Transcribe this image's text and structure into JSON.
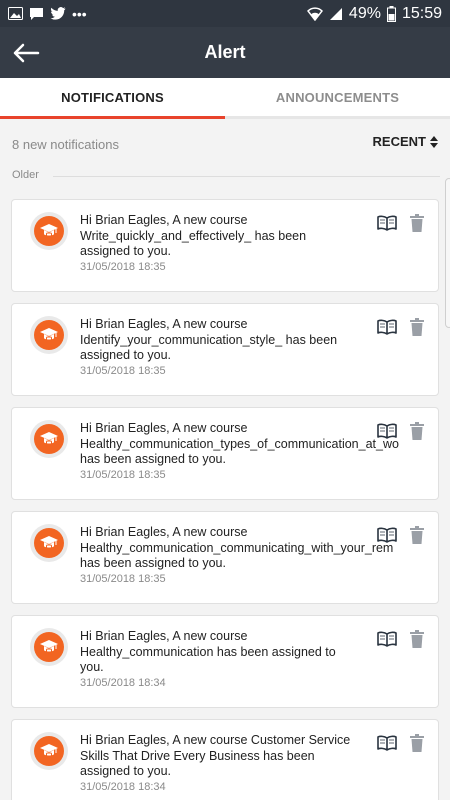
{
  "status_bar": {
    "battery": "49%",
    "time": "15:59"
  },
  "header": {
    "title": "Alert"
  },
  "tabs": [
    {
      "label": "NOTIFICATIONS",
      "active": true
    },
    {
      "label": "ANNOUNCEMENTS",
      "active": false
    }
  ],
  "summary": "8 new notifications",
  "sort_label": "RECENT",
  "section_label": "Older",
  "notifications": [
    {
      "lines": [
        "Hi Brian Eagles, A new course",
        "Write_quickly_and_effectively_ has been",
        "assigned to you."
      ],
      "timestamp": "31/05/2018 18:35"
    },
    {
      "lines": [
        "Hi Brian Eagles, A new course",
        "Identify_your_communication_style_ has been",
        "assigned to you."
      ],
      "timestamp": "31/05/2018 18:35"
    },
    {
      "lines": [
        "Hi Brian Eagles, A new course",
        "Healthy_communication_types_of_communication_at_wo",
        "has been assigned to you."
      ],
      "timestamp": "31/05/2018 18:35"
    },
    {
      "lines": [
        "Hi Brian Eagles, A new course",
        "Healthy_communication_communicating_with_your_rem",
        "has been assigned to you."
      ],
      "timestamp": "31/05/2018 18:35"
    },
    {
      "lines": [
        "Hi Brian Eagles, A new course",
        "Healthy_communication has been assigned to",
        "you."
      ],
      "timestamp": "31/05/2018 18:34"
    },
    {
      "lines": [
        "Hi Brian Eagles, A new course Customer Service",
        "Skills That Drive Every Business has been",
        "assigned to you."
      ],
      "timestamp": "31/05/2018 18:34"
    }
  ],
  "colors": {
    "header_bg": "#353c46",
    "accent": "#e8432c",
    "avatar": "#f26522"
  }
}
